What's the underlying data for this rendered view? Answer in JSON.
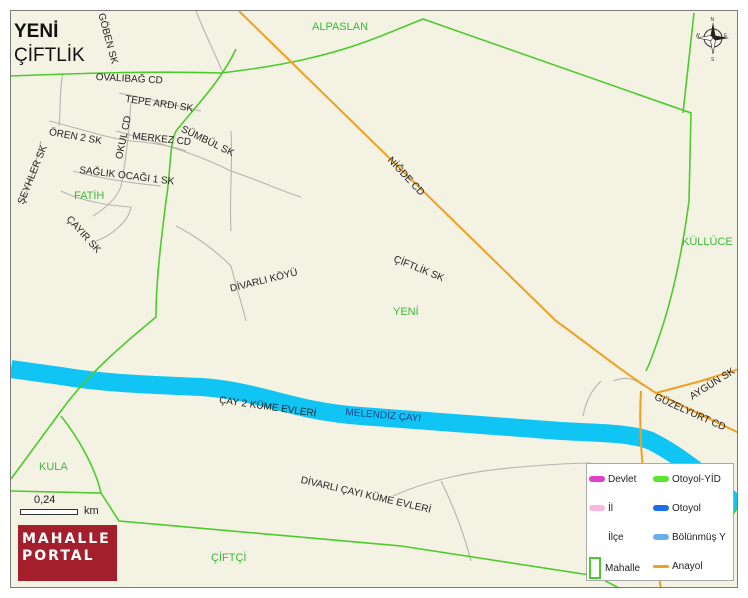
{
  "title": {
    "line1": "YENİ",
    "line2": "ÇİFTLİK"
  },
  "neighborhoods": {
    "alpaslan": "ALPASLAN",
    "fatih": "FATİH",
    "yeni": "YENİ",
    "kullüce": "KÜLLÜCE",
    "kula": "KULA",
    "ciftci": "ÇİFTÇİ"
  },
  "streets": {
    "goben": "GÖBEN SK",
    "ovalibag": "OVALIBAĞ CD",
    "tepe_ardi": "TEPE ARDI SK",
    "oren2": "ÖREN 2 SK",
    "okul": "OKUL CD",
    "merkez": "MERKEZ CD",
    "sumbul": "SÜMBÜL SK",
    "seyhler": "ŞEYHLER SK",
    "saglik": "SAĞLIK OCAĞI 1 SK",
    "cayir": "ÇAYIR SK",
    "nigde": "NİĞDE CD",
    "ciftlik": "ÇİFTLİK SK",
    "divarli_koyu": "DİVARLI KÖYÜ",
    "aygun": "AYGÜN SK",
    "guzelyurt": "GÜZELYURT CD",
    "cay2": "ÇAY 2 KÜME EVLERİ",
    "divarli_cayi": "DİVARLI ÇAYI KÜME EVLERİ"
  },
  "river": {
    "name": "MELENDİZ ÇAYI",
    "color": "#10c4f4"
  },
  "compass": {
    "n": "N",
    "e": "E",
    "w": "W",
    "s": "S"
  },
  "scale": {
    "value": "0,24",
    "unit": "km"
  },
  "logo": {
    "line1": "MAHALLE",
    "line2": "PORTAL",
    "color": "#a31f2c"
  },
  "legend": {
    "items": [
      {
        "label": "Devlet",
        "color": "#e040c8",
        "type": "road"
      },
      {
        "label": "Otoyol-YİD",
        "color": "#5ae62c",
        "type": "road"
      },
      {
        "label": "İl",
        "color": "#f8b8e0",
        "type": "road"
      },
      {
        "label": "Otoyol",
        "color": "#1a6fe8",
        "type": "road"
      },
      {
        "label": "İlçe",
        "color": "#ffffff",
        "type": "road"
      },
      {
        "label": "Bölünmüş Y",
        "color": "#6aaef0",
        "type": "road"
      },
      {
        "label": "Mahalle",
        "color": "#4ccc2c",
        "type": "area"
      },
      {
        "label": "Anayol",
        "color": "#f0a020",
        "type": "road"
      }
    ]
  },
  "colors": {
    "background": "#f4f2e3",
    "boundary": "#4ccc2c",
    "anayol": "#f0a020",
    "minor_road": "#b5b5b0"
  }
}
